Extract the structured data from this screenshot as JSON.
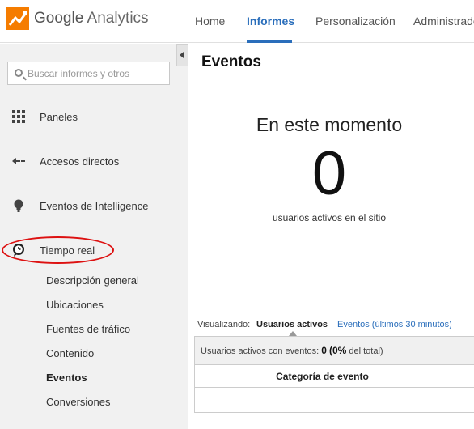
{
  "brand": {
    "google": "Google",
    "product": "Analytics"
  },
  "nav": {
    "items": [
      {
        "label": "Home"
      },
      {
        "label": "Informes"
      },
      {
        "label": "Personalización"
      },
      {
        "label": "Administrador"
      }
    ],
    "active": "Informes"
  },
  "sidebar": {
    "search_placeholder": "Buscar informes y otros",
    "items": [
      {
        "label": "Paneles",
        "icon": "grid-icon"
      },
      {
        "label": "Accesos directos",
        "icon": "shortcut-arrow-icon"
      },
      {
        "label": "Eventos de Intelligence",
        "icon": "lightbulb-icon"
      },
      {
        "label": "Tiempo real",
        "icon": "clock-icon"
      }
    ],
    "subitems": [
      {
        "label": "Descripción general"
      },
      {
        "label": "Ubicaciones"
      },
      {
        "label": "Fuentes de tráfico"
      },
      {
        "label": "Contenido"
      },
      {
        "label": "Eventos"
      },
      {
        "label": "Conversiones"
      }
    ],
    "active_subitem": "Eventos"
  },
  "main": {
    "title": "Eventos",
    "right_now": "En este momento",
    "count": "0",
    "count_label": "usuarios activos en el sitio",
    "viewing_label": "Visualizando:",
    "viewing_active": "Usuarios activos",
    "viewing_link": "Eventos (últimos 30 minutos)",
    "summary_prefix": "Usuarios activos con eventos:",
    "summary_value": "0",
    "summary_paren_open": "(",
    "summary_percent": "0%",
    "summary_rest": "del total)",
    "table_header": "Categoría de evento"
  },
  "colors": {
    "accent": "#2a6ebb",
    "highlight_oval": "#dd1111",
    "logo_orange": "#f57c00"
  }
}
